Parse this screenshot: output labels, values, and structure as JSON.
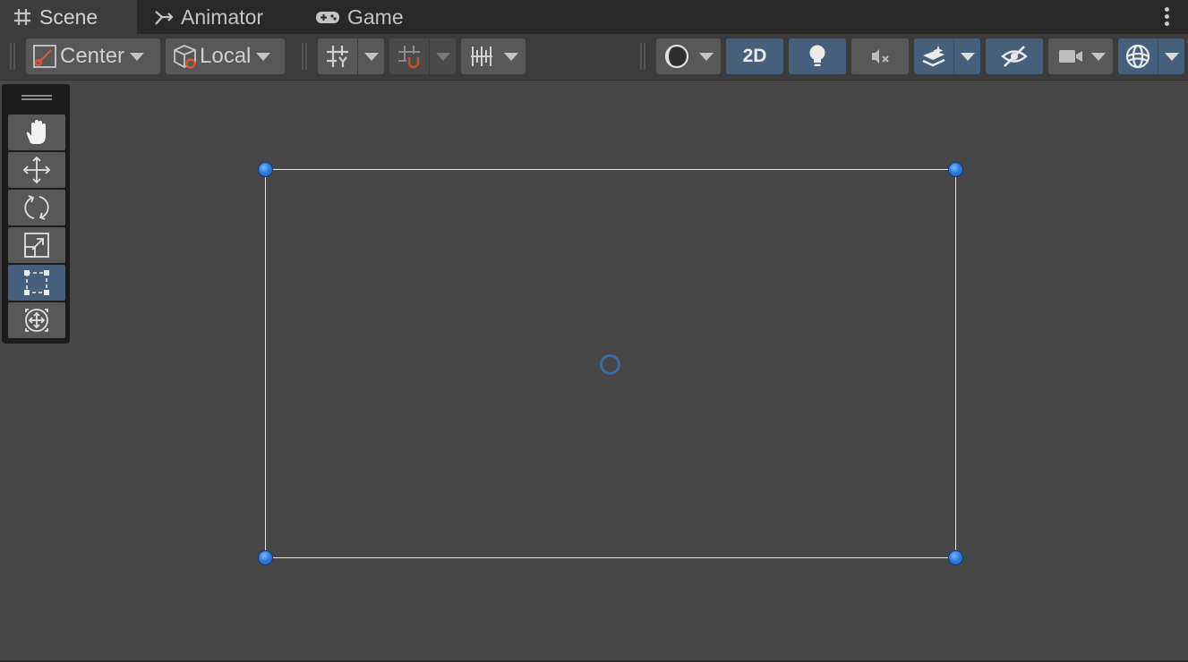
{
  "tabs": [
    {
      "label": "Scene",
      "icon": "grid-hash-icon",
      "active": true
    },
    {
      "label": "Animator",
      "icon": "animator-branch-icon",
      "active": false
    },
    {
      "label": "Game",
      "icon": "gamepad-icon",
      "active": false
    }
  ],
  "toolbar": {
    "pivot_label": "Center",
    "space_label": "Local",
    "mode_2d_label": "2D"
  },
  "tools": [
    {
      "name": "hand-tool",
      "icon": "hand-icon",
      "selected": false
    },
    {
      "name": "move-tool",
      "icon": "move-arrows-icon",
      "selected": false
    },
    {
      "name": "rotate-tool",
      "icon": "rotate-icon",
      "selected": false
    },
    {
      "name": "scale-tool",
      "icon": "scale-icon",
      "selected": false
    },
    {
      "name": "rect-tool",
      "icon": "rect-transform-icon",
      "selected": true
    },
    {
      "name": "transform-tool",
      "icon": "transform-icon",
      "selected": false
    }
  ],
  "colors": {
    "background": "#474747",
    "toolbar": "#3c3c3c",
    "button": "#585858",
    "active_blue": "#46607c",
    "handle_blue": "#2e7de0",
    "accent_orange": "#e0572d"
  }
}
